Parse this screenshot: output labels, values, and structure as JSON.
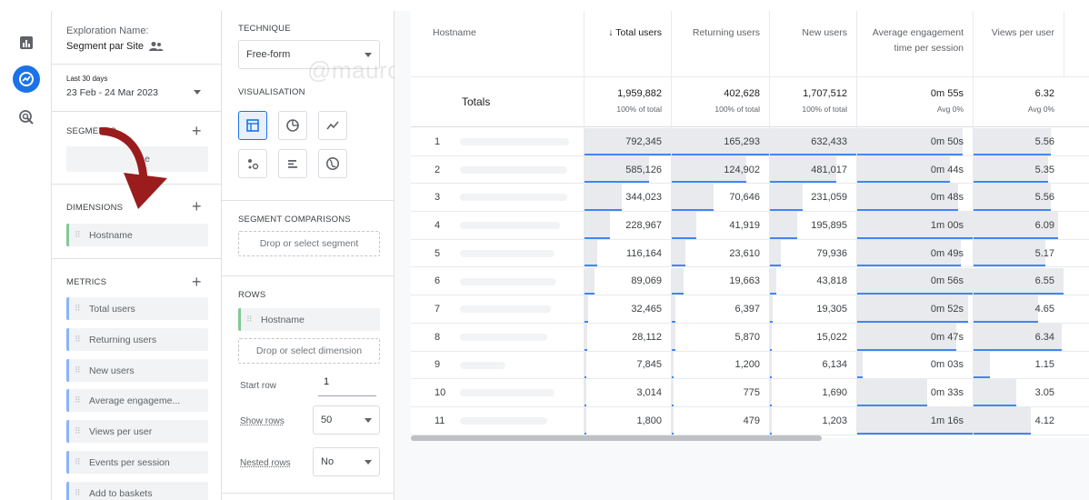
{
  "variables": {
    "exploration_name_label": "Exploration Name:",
    "exploration_name": "Segment par Site",
    "date_range_label": "Last 30 days",
    "date_range": "23 Feb - 24 Mar 2023",
    "segments_title": "SEGMENTS",
    "segment_chip_partial": "e",
    "dimensions_title": "DIMENSIONS",
    "dimensions": [
      "Hostname"
    ],
    "metrics_title": "METRICS",
    "metrics": [
      "Total users",
      "Returning users",
      "New users",
      "Average engageme...",
      "Views per user",
      "Events per session",
      "Add to baskets"
    ]
  },
  "settings": {
    "technique_title": "TECHNIQUE",
    "technique_value": "Free-form",
    "visualisation_title": "VISUALISATION",
    "segment_comparisons_title": "SEGMENT COMPARISONS",
    "segment_drop": "Drop or select segment",
    "rows_title": "ROWS",
    "rows_chip": "Hostname",
    "rows_drop": "Drop or select dimension",
    "start_row_label": "Start row",
    "start_row_value": "1",
    "show_rows_label": "Show rows",
    "show_rows_value": "50",
    "nested_rows_label": "Nested rows",
    "nested_rows_value": "No"
  },
  "watermark": "@mauroromanella.com",
  "table": {
    "headers": [
      "Hostname",
      "↓ Total users",
      "Returning users",
      "New users",
      "Average engagement time per session",
      "Views per user"
    ],
    "totals_label": "Totals",
    "totals": [
      {
        "value": "1,959,882",
        "sub": "100% of total"
      },
      {
        "value": "402,628",
        "sub": "100% of total"
      },
      {
        "value": "1,707,512",
        "sub": "100% of total"
      },
      {
        "value": "0m 55s",
        "sub": "Avg 0%"
      },
      {
        "value": "6.32",
        "sub": "Avg 0%"
      }
    ],
    "rows": [
      {
        "n": "1",
        "cells": [
          "792,345",
          "165,293",
          "632,433",
          "0m 50s",
          "5.56"
        ],
        "fill": [
          1.0,
          1.0,
          1.0,
          0.91,
          0.85
        ]
      },
      {
        "n": "2",
        "cells": [
          "585,126",
          "124,902",
          "481,017",
          "0m 44s",
          "5.35"
        ],
        "fill": [
          0.74,
          0.76,
          0.76,
          0.8,
          0.82
        ]
      },
      {
        "n": "3",
        "cells": [
          "344,023",
          "70,646",
          "231,059",
          "0m 48s",
          "5.56"
        ],
        "fill": [
          0.43,
          0.43,
          0.37,
          0.87,
          0.85
        ]
      },
      {
        "n": "4",
        "cells": [
          "228,967",
          "41,919",
          "195,895",
          "1m 00s",
          "6.09"
        ],
        "fill": [
          0.29,
          0.25,
          0.31,
          1.0,
          0.93
        ]
      },
      {
        "n": "5",
        "cells": [
          "116,164",
          "23,610",
          "79,936",
          "0m 49s",
          "5.17"
        ],
        "fill": [
          0.15,
          0.14,
          0.13,
          0.89,
          0.79
        ]
      },
      {
        "n": "6",
        "cells": [
          "89,069",
          "19,663",
          "43,818",
          "0m 56s",
          "6.55"
        ],
        "fill": [
          0.11,
          0.12,
          0.07,
          1.0,
          1.0
        ]
      },
      {
        "n": "7",
        "cells": [
          "32,465",
          "6,397",
          "19,305",
          "0m 52s",
          "4.65"
        ],
        "fill": [
          0.04,
          0.04,
          0.03,
          0.95,
          0.71
        ]
      },
      {
        "n": "8",
        "cells": [
          "28,112",
          "5,870",
          "15,022",
          "0m 47s",
          "6.34"
        ],
        "fill": [
          0.035,
          0.035,
          0.024,
          0.85,
          0.97
        ]
      },
      {
        "n": "9",
        "cells": [
          "7,845",
          "1,200",
          "6,134",
          "0m 03s",
          "1.15"
        ],
        "fill": [
          0.01,
          0.007,
          0.01,
          0.05,
          0.18
        ]
      },
      {
        "n": "10",
        "cells": [
          "3,014",
          "775",
          "1,690",
          "0m 33s",
          "3.05"
        ],
        "fill": [
          0.004,
          0.005,
          0.003,
          0.6,
          0.47
        ]
      },
      {
        "n": "11",
        "cells": [
          "1,800",
          "479",
          "1,203",
          "1m 16s",
          "4.12"
        ],
        "fill": [
          0.002,
          0.003,
          0.002,
          1.0,
          0.63
        ]
      }
    ]
  },
  "colors": {
    "accent": "#1a73e8",
    "bar_line": "#4285f4",
    "bar_fill": "#e8eaed",
    "arrow": "#9b1c1c"
  }
}
